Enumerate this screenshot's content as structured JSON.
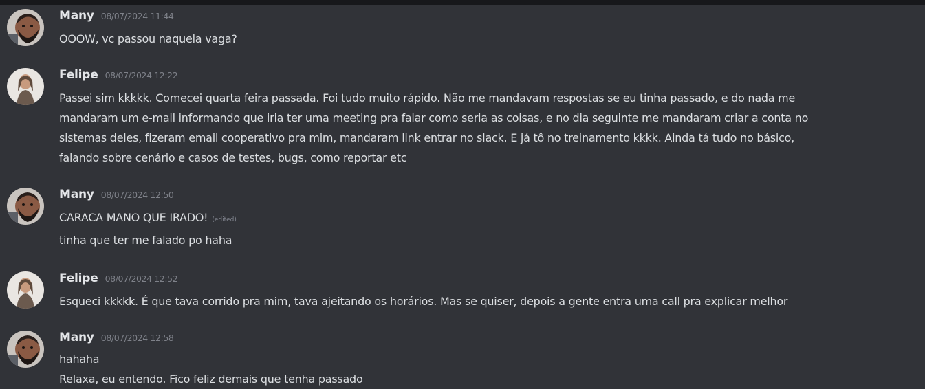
{
  "messages": [
    {
      "author": "Many",
      "timestamp": "08/07/2024 11:44",
      "avatar_icon": "bearded-man-avatar",
      "lines": [
        "OOOW, vc passou naquela vaga?"
      ]
    },
    {
      "author": "Felipe",
      "timestamp": "08/07/2024 12:22",
      "avatar_icon": "person-portrait-avatar",
      "lines": [
        "Passei sim kkkkk. Comecei quarta feira passada. Foi tudo muito rápido. Não me mandavam respostas se eu tinha passado, e do nada me",
        "mandaram um e-mail informando que iria ter uma meeting pra falar como seria as coisas, e no dia seguinte me mandaram criar a conta no",
        "sistemas deles, fizeram email cooperativo pra mim, mandaram link entrar no slack. E já tô no treinamento kkkk. Ainda tá tudo no básico,",
        "falando sobre cenário e casos de testes, bugs, como reportar etc"
      ]
    },
    {
      "author": "Many",
      "timestamp": "08/07/2024 12:50",
      "avatar_icon": "bearded-man-avatar",
      "lines": [
        "CARACA MANO QUE IRADO!",
        "tinha que ter me falado po haha"
      ],
      "edited_label": "(edited)"
    },
    {
      "author": "Felipe",
      "timestamp": "08/07/2024 12:52",
      "avatar_icon": "person-portrait-avatar",
      "lines": [
        "Esqueci kkkkk. É que tava corrido pra mim, tava ajeitando os horários. Mas se quiser, depois a gente entra uma call pra explicar melhor"
      ]
    },
    {
      "author": "Many",
      "timestamp": "08/07/2024 12:58",
      "avatar_icon": "bearded-man-avatar",
      "lines": [
        "hahaha",
        "Relaxa, eu entendo. Fico feliz demais que tenha passado"
      ]
    }
  ]
}
